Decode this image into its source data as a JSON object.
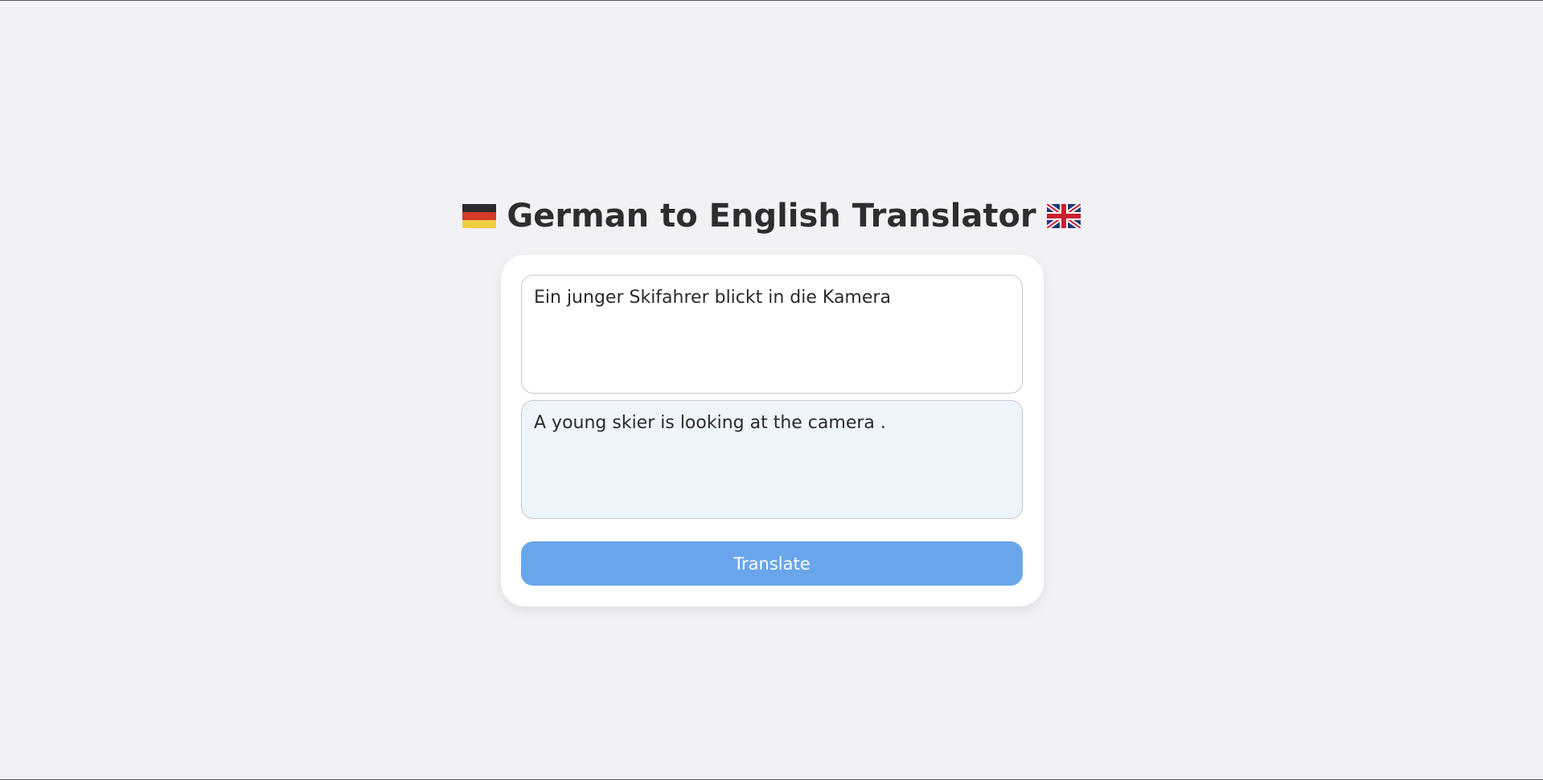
{
  "header": {
    "title": "German to English Translator",
    "left_flag_icon": "germany-flag-icon",
    "right_flag_icon": "uk-flag-icon"
  },
  "translator": {
    "input_text": "Ein junger Skifahrer blickt in die Kamera",
    "output_text": "A young skier is looking at the camera .",
    "button_label": "Translate"
  },
  "colors": {
    "page_background": "#f2f2f6",
    "card_background": "#ffffff",
    "output_background": "#eff5fd",
    "button_background": "#69a5ea",
    "button_text": "#ffffff",
    "title_text": "#2e2e2e"
  }
}
